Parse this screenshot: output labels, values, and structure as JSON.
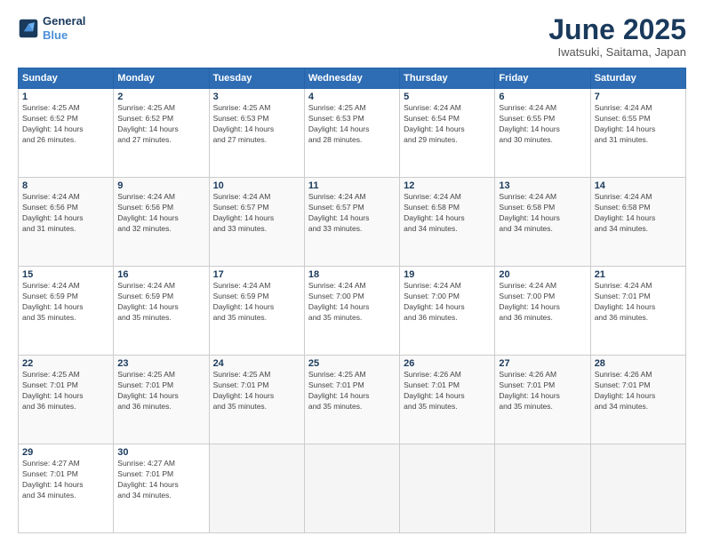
{
  "header": {
    "logo_line1": "General",
    "logo_line2": "Blue",
    "month": "June 2025",
    "location": "Iwatsuki, Saitama, Japan"
  },
  "weekdays": [
    "Sunday",
    "Monday",
    "Tuesday",
    "Wednesday",
    "Thursday",
    "Friday",
    "Saturday"
  ],
  "weeks": [
    [
      {
        "day": "1",
        "info": "Sunrise: 4:25 AM\nSunset: 6:52 PM\nDaylight: 14 hours\nand 26 minutes."
      },
      {
        "day": "2",
        "info": "Sunrise: 4:25 AM\nSunset: 6:52 PM\nDaylight: 14 hours\nand 27 minutes."
      },
      {
        "day": "3",
        "info": "Sunrise: 4:25 AM\nSunset: 6:53 PM\nDaylight: 14 hours\nand 27 minutes."
      },
      {
        "day": "4",
        "info": "Sunrise: 4:25 AM\nSunset: 6:53 PM\nDaylight: 14 hours\nand 28 minutes."
      },
      {
        "day": "5",
        "info": "Sunrise: 4:24 AM\nSunset: 6:54 PM\nDaylight: 14 hours\nand 29 minutes."
      },
      {
        "day": "6",
        "info": "Sunrise: 4:24 AM\nSunset: 6:55 PM\nDaylight: 14 hours\nand 30 minutes."
      },
      {
        "day": "7",
        "info": "Sunrise: 4:24 AM\nSunset: 6:55 PM\nDaylight: 14 hours\nand 31 minutes."
      }
    ],
    [
      {
        "day": "8",
        "info": "Sunrise: 4:24 AM\nSunset: 6:56 PM\nDaylight: 14 hours\nand 31 minutes."
      },
      {
        "day": "9",
        "info": "Sunrise: 4:24 AM\nSunset: 6:56 PM\nDaylight: 14 hours\nand 32 minutes."
      },
      {
        "day": "10",
        "info": "Sunrise: 4:24 AM\nSunset: 6:57 PM\nDaylight: 14 hours\nand 33 minutes."
      },
      {
        "day": "11",
        "info": "Sunrise: 4:24 AM\nSunset: 6:57 PM\nDaylight: 14 hours\nand 33 minutes."
      },
      {
        "day": "12",
        "info": "Sunrise: 4:24 AM\nSunset: 6:58 PM\nDaylight: 14 hours\nand 34 minutes."
      },
      {
        "day": "13",
        "info": "Sunrise: 4:24 AM\nSunset: 6:58 PM\nDaylight: 14 hours\nand 34 minutes."
      },
      {
        "day": "14",
        "info": "Sunrise: 4:24 AM\nSunset: 6:58 PM\nDaylight: 14 hours\nand 34 minutes."
      }
    ],
    [
      {
        "day": "15",
        "info": "Sunrise: 4:24 AM\nSunset: 6:59 PM\nDaylight: 14 hours\nand 35 minutes."
      },
      {
        "day": "16",
        "info": "Sunrise: 4:24 AM\nSunset: 6:59 PM\nDaylight: 14 hours\nand 35 minutes."
      },
      {
        "day": "17",
        "info": "Sunrise: 4:24 AM\nSunset: 6:59 PM\nDaylight: 14 hours\nand 35 minutes."
      },
      {
        "day": "18",
        "info": "Sunrise: 4:24 AM\nSunset: 7:00 PM\nDaylight: 14 hours\nand 35 minutes."
      },
      {
        "day": "19",
        "info": "Sunrise: 4:24 AM\nSunset: 7:00 PM\nDaylight: 14 hours\nand 36 minutes."
      },
      {
        "day": "20",
        "info": "Sunrise: 4:24 AM\nSunset: 7:00 PM\nDaylight: 14 hours\nand 36 minutes."
      },
      {
        "day": "21",
        "info": "Sunrise: 4:24 AM\nSunset: 7:01 PM\nDaylight: 14 hours\nand 36 minutes."
      }
    ],
    [
      {
        "day": "22",
        "info": "Sunrise: 4:25 AM\nSunset: 7:01 PM\nDaylight: 14 hours\nand 36 minutes."
      },
      {
        "day": "23",
        "info": "Sunrise: 4:25 AM\nSunset: 7:01 PM\nDaylight: 14 hours\nand 36 minutes."
      },
      {
        "day": "24",
        "info": "Sunrise: 4:25 AM\nSunset: 7:01 PM\nDaylight: 14 hours\nand 35 minutes."
      },
      {
        "day": "25",
        "info": "Sunrise: 4:25 AM\nSunset: 7:01 PM\nDaylight: 14 hours\nand 35 minutes."
      },
      {
        "day": "26",
        "info": "Sunrise: 4:26 AM\nSunset: 7:01 PM\nDaylight: 14 hours\nand 35 minutes."
      },
      {
        "day": "27",
        "info": "Sunrise: 4:26 AM\nSunset: 7:01 PM\nDaylight: 14 hours\nand 35 minutes."
      },
      {
        "day": "28",
        "info": "Sunrise: 4:26 AM\nSunset: 7:01 PM\nDaylight: 14 hours\nand 34 minutes."
      }
    ],
    [
      {
        "day": "29",
        "info": "Sunrise: 4:27 AM\nSunset: 7:01 PM\nDaylight: 14 hours\nand 34 minutes."
      },
      {
        "day": "30",
        "info": "Sunrise: 4:27 AM\nSunset: 7:01 PM\nDaylight: 14 hours\nand 34 minutes."
      },
      {
        "day": "",
        "info": ""
      },
      {
        "day": "",
        "info": ""
      },
      {
        "day": "",
        "info": ""
      },
      {
        "day": "",
        "info": ""
      },
      {
        "day": "",
        "info": ""
      }
    ]
  ]
}
